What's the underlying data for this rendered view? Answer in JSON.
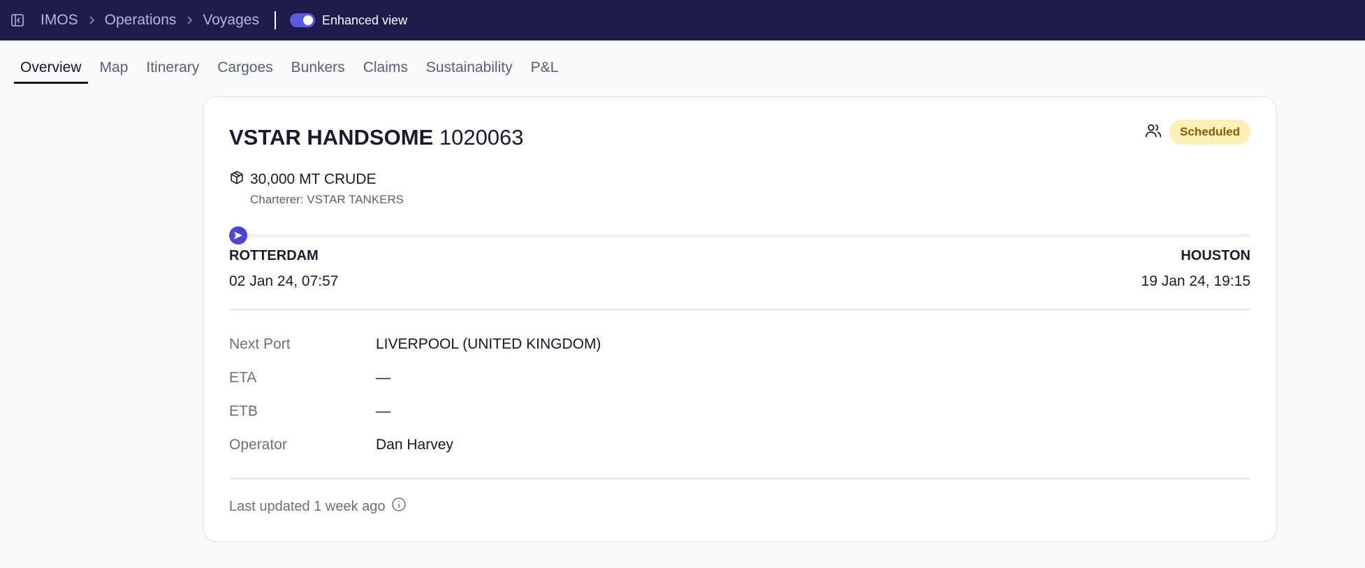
{
  "topbar": {
    "collapse_icon": "sidebar-collapse-icon",
    "breadcrumbs": [
      "IMOS",
      "Operations",
      "Voyages"
    ],
    "toggle_label": "Enhanced view",
    "toggle_on": true,
    "accent": "#5b5be0",
    "bg": "#1f1b4d"
  },
  "tabs": [
    "Overview",
    "Map",
    "Itinerary",
    "Cargoes",
    "Bunkers",
    "Claims",
    "Sustainability",
    "P&L"
  ],
  "active_tab": "Overview",
  "voyage": {
    "vessel": "VSTAR HANDSOME",
    "voyage_no": "1020063",
    "status": "Scheduled",
    "cargo": "30,000 MT CRUDE",
    "charterer": "Charterer: VSTAR TANKERS",
    "progress": 0,
    "origin": {
      "port": "ROTTERDAM",
      "date": "02 Jan 24, 07:57"
    },
    "destination": {
      "port": "HOUSTON",
      "date": "19 Jan 24, 19:15"
    },
    "details": [
      {
        "label": "Next Port",
        "value": "LIVERPOOL (UNITED KINGDOM)"
      },
      {
        "label": "ETA",
        "value": "—"
      },
      {
        "label": "ETB",
        "value": "—"
      },
      {
        "label": "Operator",
        "value": "Dan Harvey"
      }
    ],
    "last_updated": "Last updated 1 week ago"
  }
}
